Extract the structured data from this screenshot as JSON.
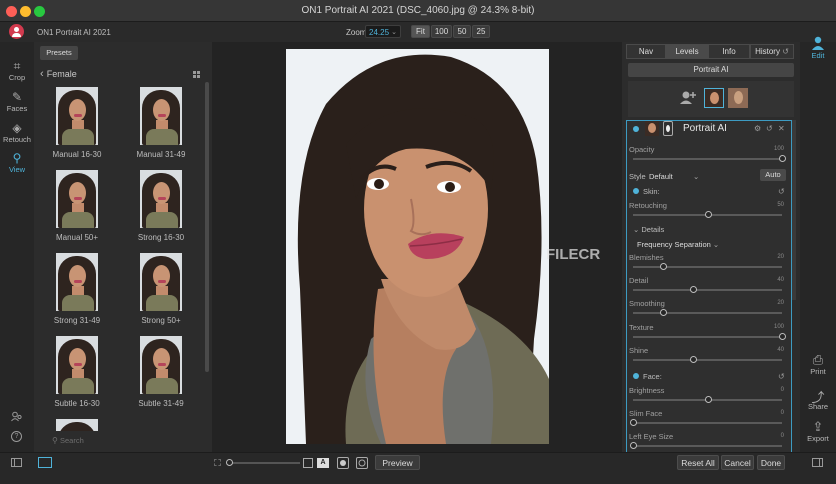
{
  "window": {
    "title": "ON1 Portrait AI 2021 (DSC_4060.jpg @ 24.3% 8-bit)"
  },
  "topbar": {
    "app_name": "ON1 Portrait AI 2021",
    "zoom_label": "Zoom",
    "zoom_value": "24.25",
    "zoom_presets": [
      "Fit",
      "100",
      "50",
      "25"
    ]
  },
  "left_tools": [
    {
      "label": "Crop",
      "icon": "crop-icon"
    },
    {
      "label": "Faces",
      "icon": "faces-icon"
    },
    {
      "label": "Retouch",
      "icon": "retouch-icon"
    },
    {
      "label": "View",
      "icon": "view-icon",
      "active": true
    }
  ],
  "presets": {
    "tab": "Presets",
    "folder": "Female",
    "items": [
      "Manual 16-30",
      "Manual 31-49",
      "Manual 50+",
      "Strong 16-30",
      "Strong 31-49",
      "Strong 50+",
      "Subtle 16-30",
      "Subtle 31-49"
    ],
    "search_placeholder": "Search"
  },
  "watermark": "FILECR",
  "right_tabs": [
    "Nav",
    "Levels",
    "Info",
    "History"
  ],
  "portrait_ai_button": "Portrait AI",
  "module": {
    "title": "Portrait AI",
    "opacity": {
      "label": "Opacity",
      "value": "100",
      "pct": 100
    },
    "style": {
      "label": "Style",
      "value": "Default",
      "auto": "Auto"
    },
    "skin": {
      "label": "Skin",
      "retouching": {
        "label": "Retouching",
        "value": "50",
        "pct": 50
      },
      "details_label": "Details",
      "mode": "Frequency Separation",
      "blemishes": {
        "label": "Blemishes",
        "value": "20",
        "pct": 20
      },
      "detail": {
        "label": "Detail",
        "value": "40",
        "pct": 40
      },
      "smoothing": {
        "label": "Smoothing",
        "value": "20",
        "pct": 20
      },
      "texture": {
        "label": "Texture",
        "value": "100",
        "pct": 100
      },
      "shine": {
        "label": "Shine",
        "value": "40",
        "pct": 40
      }
    },
    "face": {
      "label": "Face",
      "brightness": {
        "label": "Brightness",
        "value": "0",
        "pct": 50
      },
      "slim_face": {
        "label": "Slim Face",
        "value": "0",
        "pct": 0
      },
      "left_eye_size": {
        "label": "Left Eye Size",
        "value": "0",
        "pct": 0
      }
    }
  },
  "right_tools": [
    {
      "label": "Edit",
      "icon": "edit-person-icon",
      "active": true
    },
    {
      "label": "Print",
      "icon": "print-icon"
    },
    {
      "label": "Share",
      "icon": "share-icon"
    },
    {
      "label": "Export",
      "icon": "export-icon"
    }
  ],
  "bottom": {
    "preview": "Preview",
    "reset_all": "Reset All",
    "cancel": "Cancel",
    "done": "Done"
  }
}
